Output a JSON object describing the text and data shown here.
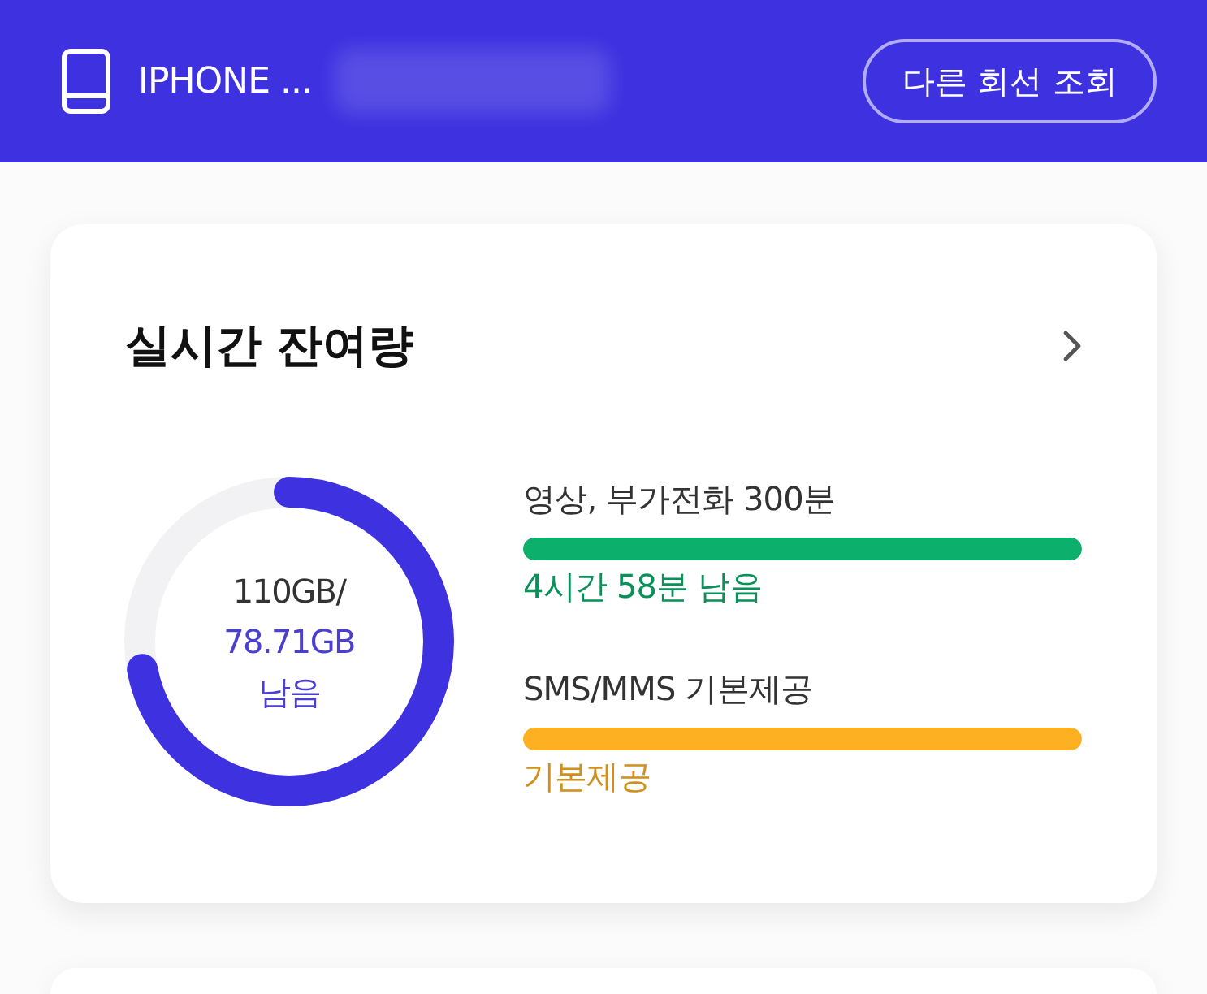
{
  "header": {
    "device_name": "IPHONE ...",
    "button": "다른 회선 조회"
  },
  "card": {
    "title": "실시간 잔여량",
    "data_usage": {
      "total": "110GB/",
      "remaining": "78.71GB",
      "remaining_unit": "남음",
      "level": 0.72
    },
    "allowances": [
      {
        "label": "영상, 부가전화 300분",
        "level": 1,
        "status": "4시간 58분 남음",
        "color": "#0cb06c"
      },
      {
        "label": "SMS/MMS 기본제공",
        "level": 1,
        "status": "기본제공",
        "color": "#fdb022"
      }
    ]
  }
}
